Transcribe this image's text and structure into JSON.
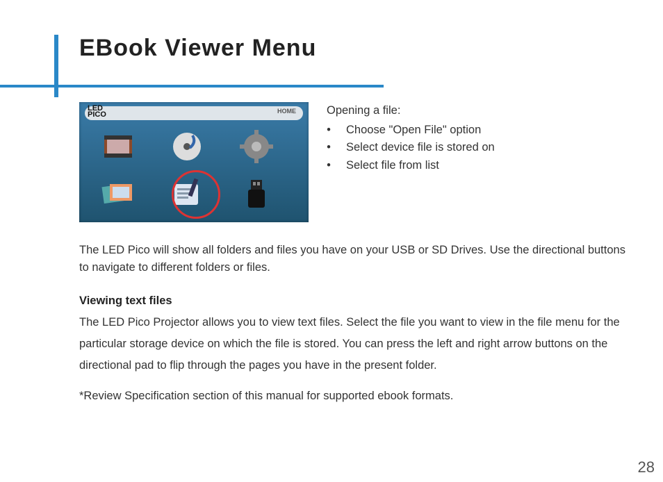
{
  "title": "EBook Viewer Menu",
  "photo": {
    "logo_line1": "LED",
    "logo_line2": "PICO",
    "home_label": "HOME"
  },
  "opening": {
    "lead": "Opening a file:",
    "bullets": [
      "Choose \"Open File\" option",
      "Select device file is stored on",
      "Select file from list"
    ]
  },
  "para1": "The LED Pico will show all folders and files you have on your USB or SD Drives. Use the directional buttons to navigate to different folders or files.",
  "section_heading": "Viewing text files",
  "section_body": "The LED Pico Projector allows you to view text files.  Select the file you want to view in the file menu for the particular storage device on which the file is stored.  You can press the left and right arrow buttons on the directional pad to flip through the pages you have in the present folder.",
  "footnote": "*Review Specification section of this manual for supported ebook formats.",
  "page_number": "28"
}
